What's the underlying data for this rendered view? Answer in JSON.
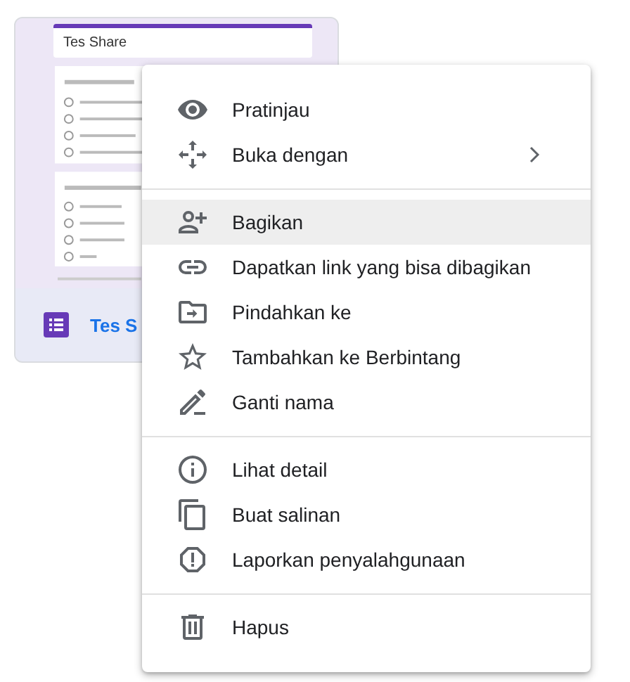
{
  "file_card": {
    "preview_title": "Tes Share",
    "name": "Tes S"
  },
  "context_menu": {
    "sections": [
      {
        "items": [
          {
            "label": "Pratinjau",
            "submenu": false,
            "selected": false
          },
          {
            "label": "Buka dengan",
            "submenu": true,
            "selected": false
          }
        ]
      },
      {
        "items": [
          {
            "label": "Bagikan",
            "submenu": false,
            "selected": true
          },
          {
            "label": "Dapatkan link yang bisa dibagikan",
            "submenu": false,
            "selected": false
          },
          {
            "label": "Pindahkan ke",
            "submenu": false,
            "selected": false
          },
          {
            "label": "Tambahkan ke Berbintang",
            "submenu": false,
            "selected": false
          },
          {
            "label": "Ganti nama",
            "submenu": false,
            "selected": false
          }
        ]
      },
      {
        "items": [
          {
            "label": "Lihat detail",
            "submenu": false,
            "selected": false
          },
          {
            "label": "Buat salinan",
            "submenu": false,
            "selected": false
          },
          {
            "label": "Laporkan penyalahgunaan",
            "submenu": false,
            "selected": false
          }
        ]
      },
      {
        "items": [
          {
            "label": "Hapus",
            "submenu": false,
            "selected": false
          }
        ]
      }
    ]
  }
}
